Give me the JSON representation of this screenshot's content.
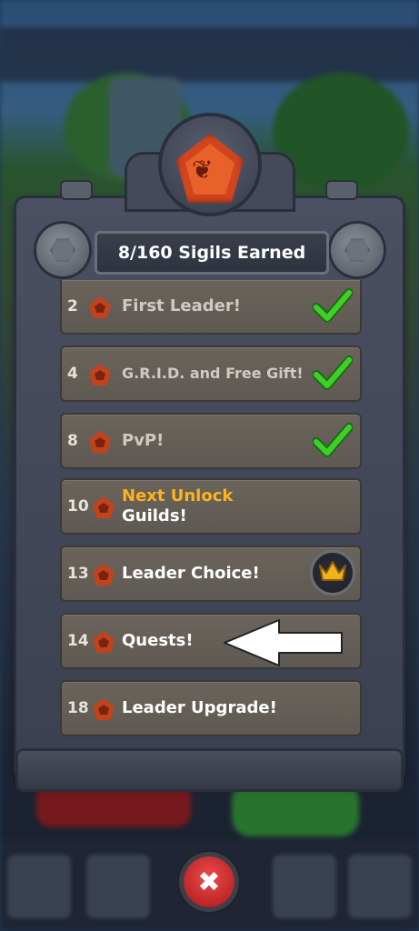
{
  "header": {
    "title": "8/160 Sigils Earned"
  },
  "milestones": [
    {
      "level": "2",
      "label": "First Leader!",
      "status": "claimed"
    },
    {
      "level": "4",
      "label": "G.R.I.D. and Free Gift!",
      "status": "claimed"
    },
    {
      "level": "8",
      "label": "PvP!",
      "status": "claimed"
    },
    {
      "level": "10",
      "highlight": "Next Unlock",
      "label": "Guilds!",
      "status": "next"
    },
    {
      "level": "13",
      "label": "Leader Choice!",
      "status": "reward-crown"
    },
    {
      "level": "14",
      "label": "Quests!",
      "status": "locked"
    },
    {
      "level": "18",
      "label": "Leader Upgrade!",
      "status": "locked"
    }
  ],
  "colors": {
    "check": "#3ecf2a",
    "highlight": "#ffb21c",
    "close": "#d83030",
    "sigil": "#c2421c"
  },
  "icons": {
    "close": "close-icon",
    "arrow": "left-arrow-pointer",
    "crest": "dragon-sigil-icon"
  }
}
